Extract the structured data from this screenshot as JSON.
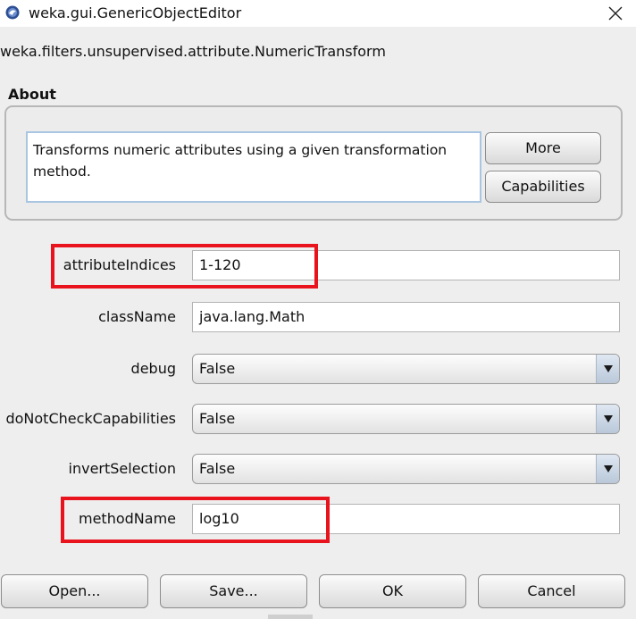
{
  "window": {
    "title": "weka.gui.GenericObjectEditor",
    "icon": "weka-bird-icon"
  },
  "editor": {
    "class_name": "weka.filters.unsupervised.attribute.NumericTransform"
  },
  "about": {
    "label": "About",
    "description": "Transforms numeric attributes using a given transformation method.",
    "more_label": "More",
    "capabilities_label": "Capabilities"
  },
  "properties": {
    "attributeIndices": {
      "label": "attributeIndices",
      "value": "1-120"
    },
    "className": {
      "label": "className",
      "value": "java.lang.Math"
    },
    "debug": {
      "label": "debug",
      "value": "False"
    },
    "doNotCheckCapabilities": {
      "label": "doNotCheckCapabilities",
      "value": "False"
    },
    "invertSelection": {
      "label": "invertSelection",
      "value": "False"
    },
    "methodName": {
      "label": "methodName",
      "value": "log10"
    }
  },
  "buttons": {
    "open": "Open...",
    "save": "Save...",
    "ok": "OK",
    "cancel": "Cancel"
  },
  "colors": {
    "highlight": "#e8131d",
    "background": "#eeeeee",
    "text_area_border": "#a9c5e2"
  }
}
